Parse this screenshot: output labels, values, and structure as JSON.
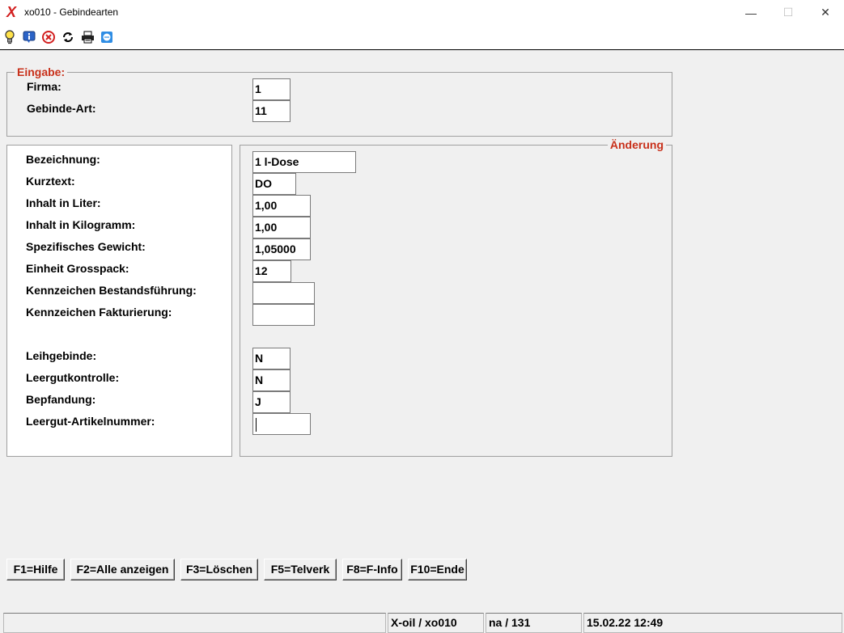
{
  "window": {
    "title": "xo010 - Gebindearten",
    "app_logo": "X",
    "minimize": "—",
    "maximize": "☐",
    "close": "✕"
  },
  "toolbar": {
    "icons": [
      "lightbulb-icon",
      "info-icon",
      "cancel-icon",
      "refresh-icon",
      "printer-icon",
      "chat-icon"
    ]
  },
  "eingabe": {
    "legend": "Eingabe:",
    "firma_label": "Firma:",
    "firma_value": "1",
    "gebinde_art_label": "Gebinde-Art:",
    "gebinde_art_value": "11"
  },
  "aenderung": {
    "legend": "Änderung"
  },
  "fields": {
    "bezeichnung": {
      "label": "Bezeichnung:",
      "value": "1 l-Dose"
    },
    "kurztext": {
      "label": "Kurztext:",
      "value": "DO"
    },
    "inhalt_liter": {
      "label": "Inhalt in Liter:",
      "value": "1,00"
    },
    "inhalt_kg": {
      "label": "Inhalt in Kilogramm:",
      "value": "1,00"
    },
    "spez_gewicht": {
      "label": "Spezifisches Gewicht:",
      "value": "1,05000"
    },
    "grosspack": {
      "label": "Einheit Grosspack:",
      "value": "12"
    },
    "kz_bestand": {
      "label": "Kennzeichen Bestandsführung:",
      "value": ""
    },
    "kz_faktur": {
      "label": "Kennzeichen Fakturierung:",
      "value": ""
    },
    "leihgebinde": {
      "label": "Leihgebinde:",
      "value": "N"
    },
    "leergutkontrolle": {
      "label": "Leergutkontrolle:",
      "value": "N"
    },
    "bepfandung": {
      "label": "Bepfandung:",
      "value": "J"
    },
    "leergut_artikel": {
      "label": "Leergut-Artikelnummer:",
      "value": ""
    }
  },
  "fkeys": {
    "f1": "F1=Hilfe",
    "f2": "F2=Alle anzeigen",
    "f3": "F3=Löschen",
    "f5": "F5=Telverk",
    "f8": "F8=F-Info",
    "f10": "F10=Ende"
  },
  "status": {
    "app": "X-oil / xo010",
    "user": "na / 131",
    "datetime": "15.02.22 12:49"
  },
  "colors": {
    "legend_red": "#c8301a",
    "logo_red": "#d21f1f"
  }
}
